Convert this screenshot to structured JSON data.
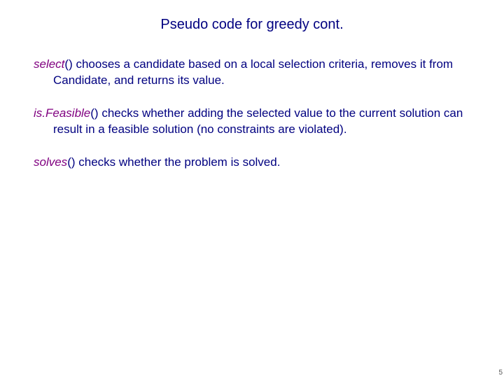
{
  "title": "Pseudo code for greedy cont.",
  "entries": [
    {
      "fn": "select",
      "paren": "()",
      "text": " chooses a candidate based on a local selection criteria, removes it from Candidate, and returns its value."
    },
    {
      "fn": "is.Feasible",
      "paren": "()",
      "text": " checks whether adding the selected value to the current solution can result in a feasible solution (no constraints are violated)."
    },
    {
      "fn": "solves",
      "paren": "()",
      "text": " checks whether the problem is solved."
    }
  ],
  "page_number": "5"
}
